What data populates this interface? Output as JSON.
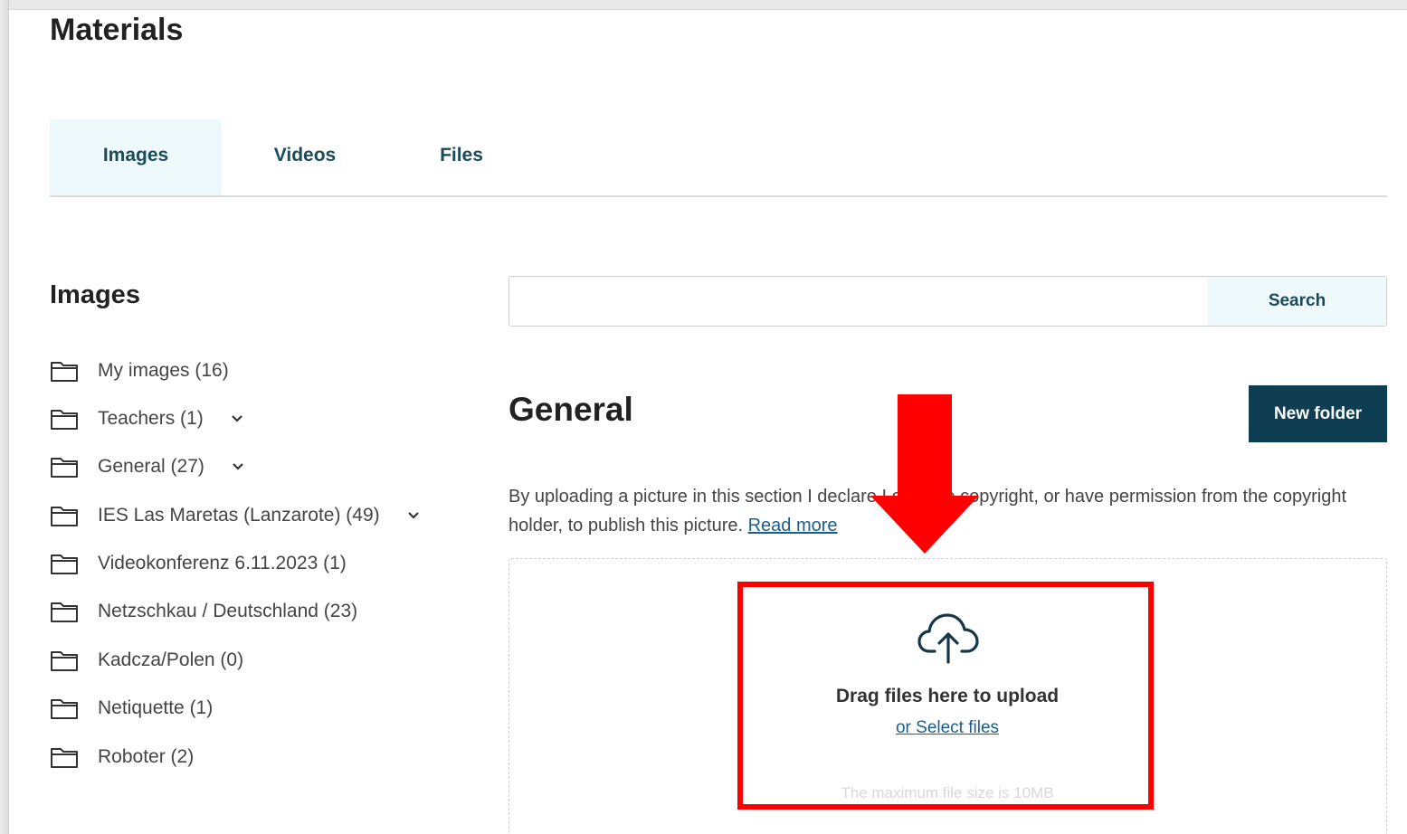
{
  "page": {
    "title": "Materials"
  },
  "tabs": [
    {
      "label": "Images",
      "active": true
    },
    {
      "label": "Videos",
      "active": false
    },
    {
      "label": "Files",
      "active": false
    }
  ],
  "sidebar": {
    "title": "Images",
    "folders": [
      {
        "label": "My images (16)",
        "expandable": false
      },
      {
        "label": "Teachers (1)",
        "expandable": true
      },
      {
        "label": "General (27)",
        "expandable": true
      },
      {
        "label": "IES Las Maretas (Lanzarote) (49)",
        "expandable": true
      },
      {
        "label": "Videokonferenz 6.11.2023 (1)",
        "expandable": false
      },
      {
        "label": "Netzschkau / Deutschland (23)",
        "expandable": false
      },
      {
        "label": "Kadcza/Polen (0)",
        "expandable": false
      },
      {
        "label": "Netiquette (1)",
        "expandable": false
      },
      {
        "label": "Roboter (2)",
        "expandable": false
      }
    ]
  },
  "search": {
    "value": "",
    "button_label": "Search"
  },
  "main": {
    "section_title": "General",
    "new_folder_label": "New folder",
    "disclaimer_text": "By uploading a picture in this section I declare I own the copyright, or have permission from the copyright holder, to publish this picture.",
    "disclaimer_link": "Read more"
  },
  "upload": {
    "drag_text": "Drag files here to upload",
    "select_link": "or Select files",
    "size_note": "The maximum file size is 10MB",
    "icon": "cloud-upload-icon"
  },
  "annotation": {
    "highlight_color": "#ff0000",
    "arrow_icon": "red-down-arrow"
  },
  "colors": {
    "accent": "#1b4a5a",
    "button_dark": "#0f3d52",
    "tab_active_bg": "#eef9fb",
    "link": "#1b5e8a"
  }
}
